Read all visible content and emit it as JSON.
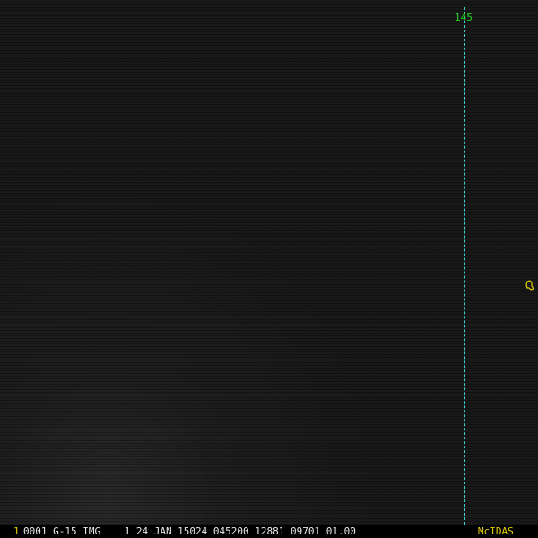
{
  "display": {
    "background_color": "#151515",
    "meridian_line_color": "#3fd1d1",
    "meridian_label_color": "#26d326",
    "annotation_color": "#e6d000",
    "info_text_color": "#e8e8e8"
  },
  "grid": {
    "meridian_label": "145"
  },
  "coastline": {
    "icon": "coastline-fragment-icon"
  },
  "info_bar": {
    "frame_number": "1",
    "image_info": "0001 G-15 IMG    1 24 JAN 15024 045200 12881 09701 01.00",
    "software": "McIDAS"
  }
}
